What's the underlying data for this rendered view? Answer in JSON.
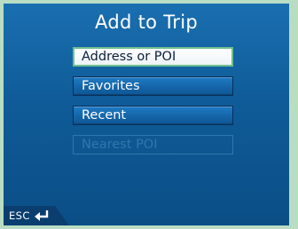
{
  "dialog": {
    "title": "Add to Trip"
  },
  "menu": {
    "items": [
      {
        "label": "Address or POI",
        "state": "selected"
      },
      {
        "label": "Favorites",
        "state": "normal"
      },
      {
        "label": "Recent",
        "state": "normal"
      },
      {
        "label": "Nearest POI",
        "state": "disabled"
      }
    ]
  },
  "footer": {
    "esc_label": "ESC",
    "back_icon": "return-arrow-icon"
  },
  "colors": {
    "screen_background": "#1565a9",
    "bezel": "#b9ddc3",
    "selected_border": "#6fbf8e",
    "disabled_text": "#2e77ad"
  }
}
